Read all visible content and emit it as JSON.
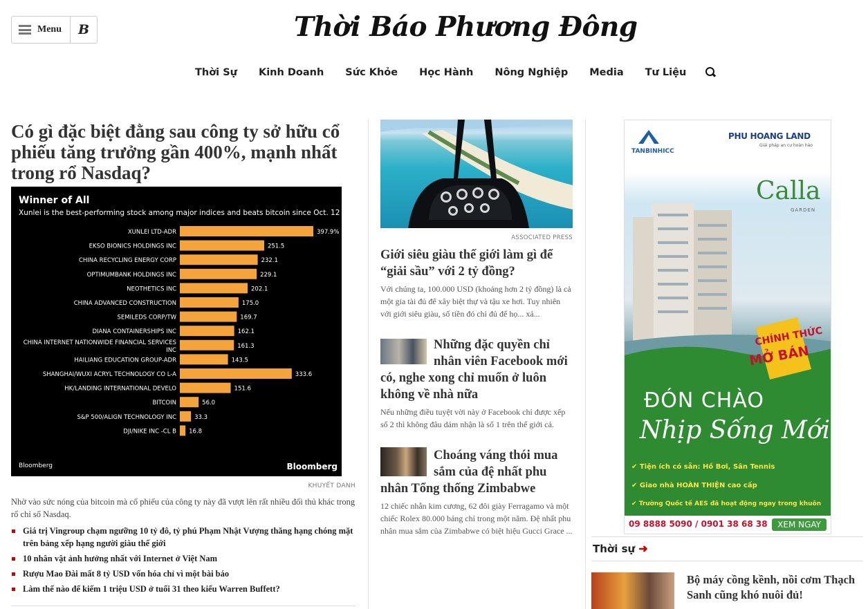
{
  "header": {
    "menu_label": "Menu",
    "b_label": "B",
    "logo_text": "Thời Báo Phương Đông"
  },
  "nav": [
    "Thời Sự",
    "Kinh Doanh",
    "Sức Khỏe",
    "Học Hành",
    "Nông Nghiệp",
    "Media",
    "Tư Liệu"
  ],
  "lead": {
    "headline": "Có gì đặc biệt đằng sau công ty sở hữu cổ phiếu tăng trưởng gần 400%, mạnh nhất trong rổ Nasdaq?",
    "credit": "KHUYẾT DANH",
    "lede": "Nhờ vào sức nóng của bitcoin mà cổ phiếu của công ty này đã vượt lên rất nhiều đối thủ khác trong rổ chỉ số Nasdaq.",
    "related": [
      "Giá trị Vingroup chạm ngưỡng 10 tỷ đô, tỷ phú Phạm Nhật Vượng thăng hạng chóng mặt trên bảng xếp hạng người giàu thế giới",
      "10 nhân vật ảnh hưởng nhất với Internet ở Việt Nam",
      "Rượu Mao Đài mất 8 tỷ USD vốn hóa chỉ vì một bài báo",
      "Làm thế nào để kiếm 1 triệu USD ở tuổi 31 theo kiểu Warren Buffett?"
    ]
  },
  "chart_data": {
    "type": "bar",
    "title": "Winner of All",
    "subtitle": "Xunlei is the best-performing stock among major indices and beats bitcoin since Oct. 12",
    "footer": "Bloomberg",
    "logo": "Bloomberg",
    "bar_color": "#f5a33b",
    "categories": [
      "XUNLEI LTD-ADR",
      "EKSO BIONICS HOLDINGS INC",
      "CHINA RECYCLING ENERGY CORP",
      "OPTIMUMBANK HOLDINGS INC",
      "NEOTHETICS INC",
      "CHINA ADVANCED CONSTRUCTION",
      "SEMILEDS CORP/TW",
      "DIANA CONTAINERSHIPS INC",
      "CHINA INTERNET NATIONWIDE FINANCIAL SERVICES INC",
      "HAILIANG EDUCATION GROUP-ADR",
      "SHANGHAI/WUXI ACRYL TECHNOLOGY CO L-A",
      "HK/LANDING INTERNATIONAL DEVELO",
      "BITCOIN",
      "S&P 500/ALIGN TECHNOLOGY INC",
      "DJI/NIKE INC -CL B"
    ],
    "values": [
      397.9,
      251.5,
      232.1,
      229.1,
      202.1,
      175.0,
      169.7,
      162.1,
      161.3,
      143.5,
      333.6,
      151.6,
      56.0,
      33.3,
      16.8
    ],
    "value_labels": [
      "397.9%",
      "251.5",
      "232.1",
      "229.1",
      "202.1",
      "175.0",
      "169.7",
      "162.1",
      "161.3",
      "143.5",
      "333.6",
      "151.6",
      "56.0",
      "33.3",
      "16.8"
    ]
  },
  "middle": {
    "photo_credit": "ASSOCIATED PRESS",
    "story1": {
      "title": "Giới siêu giàu thế giới làm gì để “giải sầu” với 2 tỷ đồng?",
      "summary": "Với chúng ta, 100.000 USD (khoảng hơn 2 tỷ đồng) là cả một gia tài đủ để xây biệt thự và tậu xe hơi. Tuy nhiên với giới siêu giàu, số tiền đó chỉ đủ để họ... xả..."
    },
    "story2": {
      "title": "Những đặc quyền chỉ nhân viên Facebook mới có, nghe xong chỉ muốn ở luôn không về nhà nữa",
      "summary": "Nếu những điều tuyệt vời này ở Facebook chỉ được xếp số 2 thì không đâu dám nhận là số 1 trên thế giới cả."
    },
    "story3": {
      "title": "Choáng váng thói mua sắm của đệ nhất phu nhân Tổng thống Zimbabwe",
      "summary": "12 chiếc nhẫn kim cương, 62 đôi giày Ferragamo và một chiếc Rolex 80.000 bảng chỉ trong một năm. Đệ nhất phu nhân mua sắm của Zimbabwe có biệt hiệu Gucci Grace ..."
    }
  },
  "ad": {
    "brand1": "TANBINHICC",
    "brand2": "PHU HOANG LAND",
    "brand2_tagline": "Giải pháp an cư hoàn hảo",
    "project": "Calla",
    "project_sub": "GARDEN",
    "badge_line1": "CHÍNH THỨC",
    "badge_line2": "MỞ BÁN",
    "greeting": "ĐÓN CHÀO",
    "slogan": "Nhịp Sống Mới",
    "bullets": [
      "Tiện ích có sẵn: Hồ Bơi, Sân Tennis",
      "Giao nhà HOÀN THIỆN cao cấp",
      "Trường Quốc tế AES đã hoạt động ngay trong khuôn viên dự án"
    ],
    "phone": "09 8888 5090 / 0901 38 68 38",
    "cta": "XEM NGAY"
  },
  "section": {
    "title": "Thời sự",
    "story_title": "Bộ máy cồng kềnh, nồi cơm Thạch Sanh cũng khó nuôi đủ!"
  }
}
